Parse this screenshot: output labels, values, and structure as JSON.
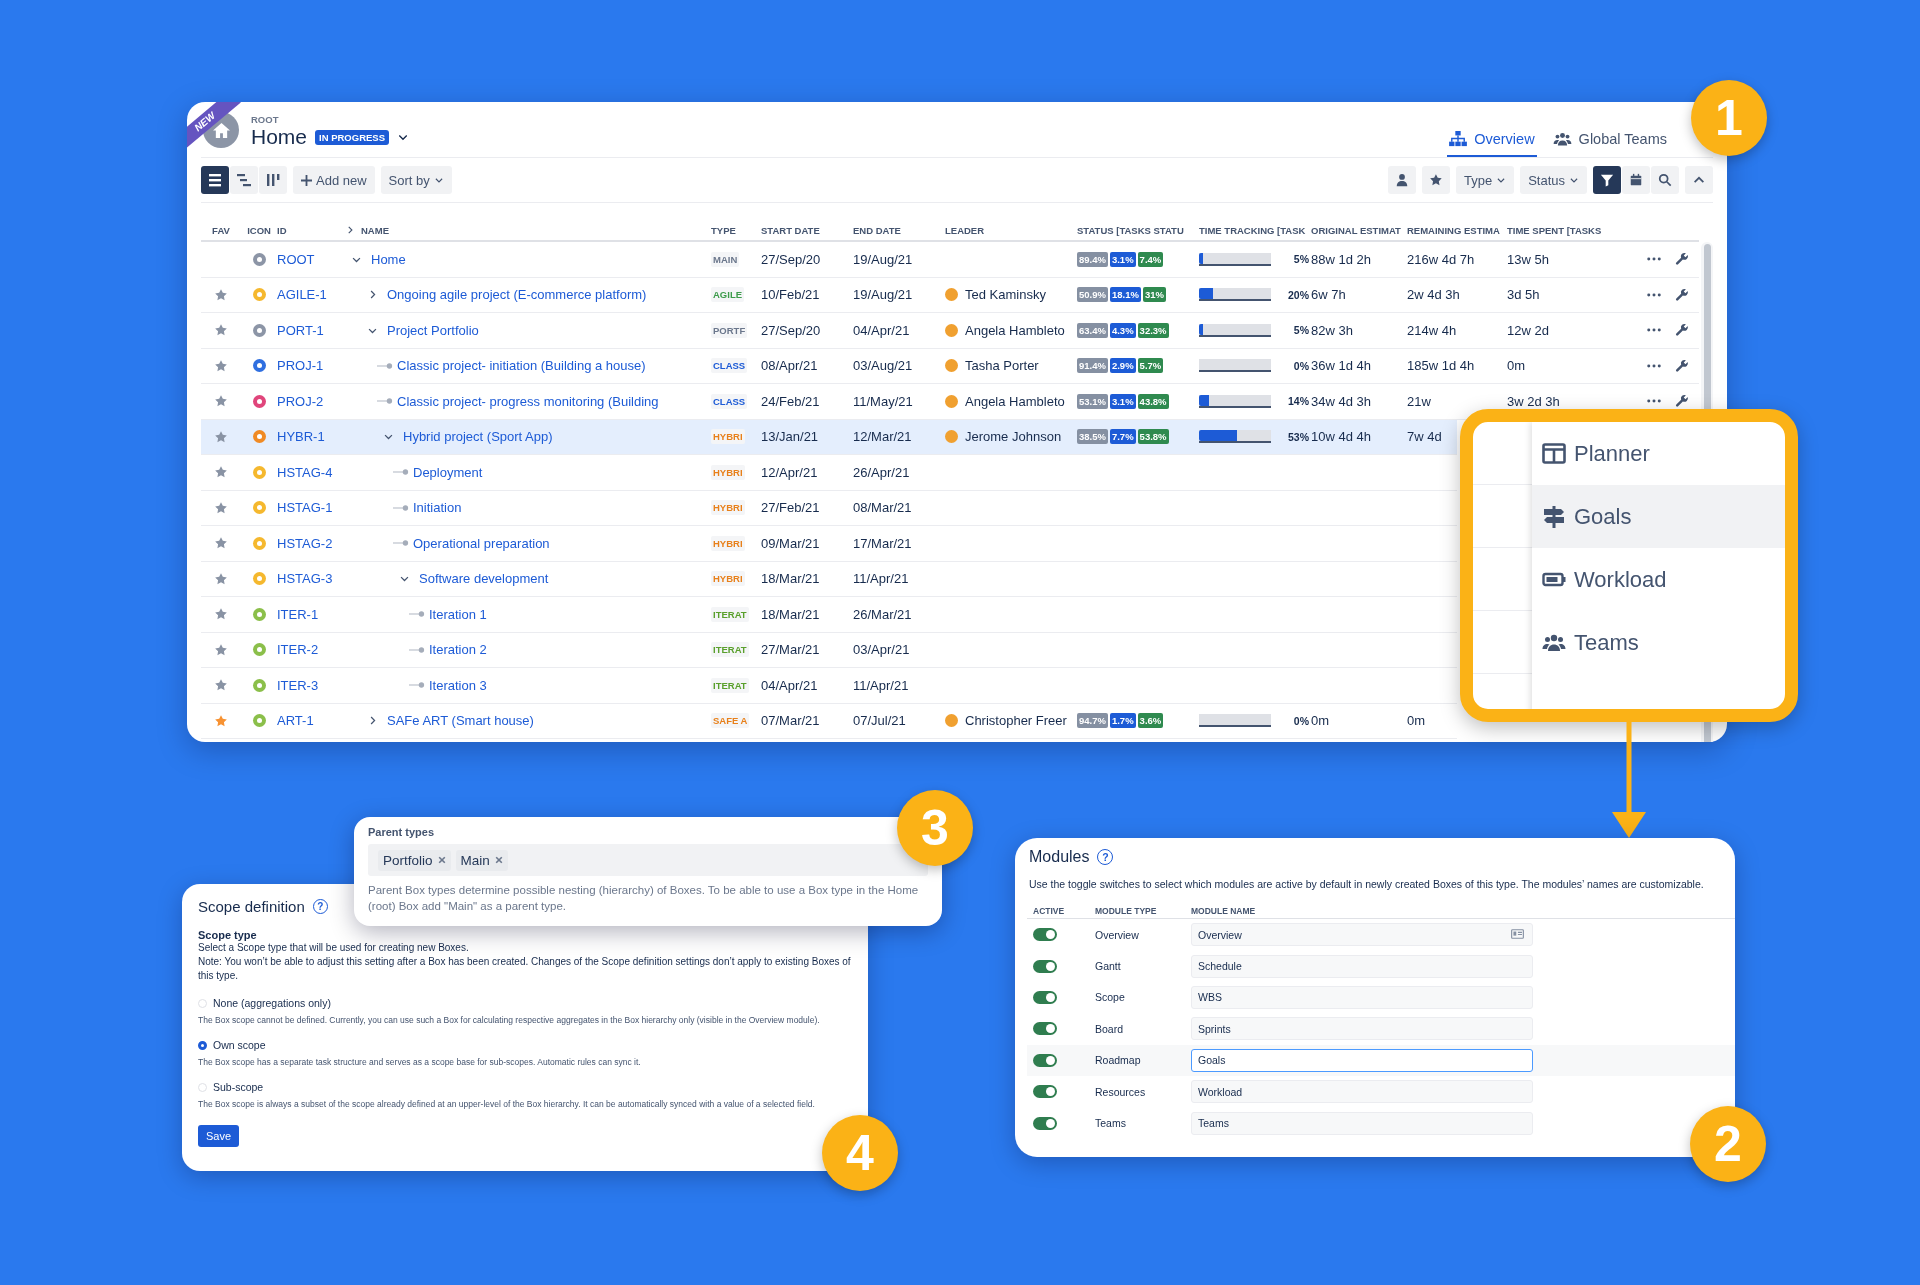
{
  "badges": [
    "1",
    "2",
    "3",
    "4"
  ],
  "header": {
    "ribbon": "NEW",
    "breadcrumb": "ROOT",
    "title": "Home",
    "status": "IN PROGRESS"
  },
  "tabs": [
    {
      "label": "Overview",
      "selected": true
    },
    {
      "label": "Global Teams",
      "selected": false
    }
  ],
  "toolbar": {
    "views": [
      {
        "selected": true
      },
      {
        "selected": false
      },
      {
        "selected": false
      }
    ],
    "add_new": "Add new",
    "sort_by": "Sort by",
    "type_filter": "Type",
    "status_filter": "Status",
    "filter_active": true
  },
  "table": {
    "columns": [
      "FAV",
      "ICON",
      "ID",
      "NAME",
      "TYPE",
      "START DATE",
      "END DATE",
      "LEADER",
      "STATUS [TASKS STATU",
      "TIME TRACKING [TASK",
      "ORIGINAL ESTIMAT",
      "REMAINING ESTIMA",
      "TIME SPENT [TASKS"
    ],
    "rows": [
      {
        "id": "ROOT",
        "name": "Home",
        "color": "#8c95a6",
        "type": {
          "label": "MAIN",
          "color": "#6b778c"
        },
        "start": "27/Sep/20",
        "end": "19/Aug/21",
        "status": [
          "89.4%",
          "3.1%",
          "7.4%"
        ],
        "tracking": {
          "level": 0.05,
          "reading": "5%"
        },
        "original": "88w 1d 2h",
        "remaining": "216w 4d 7h",
        "spent": "13w 5h",
        "actions": true,
        "selected": false,
        "kind": "branch",
        "expanded": true,
        "children": [
          {
            "id": "AGILE-1",
            "name": "Ongoing agile project (E-commerce platform)",
            "favorite": false,
            "color": "#f5b82e",
            "type": {
              "label": "AGILE",
              "color": "#3c9b4a"
            },
            "start": "10/Feb/21",
            "end": "19/Aug/21",
            "leader": "Ted Kaminsky",
            "status": [
              "50.9%",
              "18.1%",
              "31%"
            ],
            "tracking": {
              "level": 0.2,
              "reading": "20%"
            },
            "original": "6w 7h",
            "remaining": "2w 4d 3h",
            "spent": "3d 5h",
            "actions": true,
            "selected": false,
            "kind": "branch",
            "expanded": false
          },
          {
            "id": "PORT-1",
            "name": "Project Portfolio",
            "favorite": false,
            "color": "#8c95a6",
            "type": {
              "label": "PORTF",
              "color": "#6b778c"
            },
            "start": "27/Sep/20",
            "end": "04/Apr/21",
            "leader": "Angela Hambleto",
            "status": [
              "63.4%",
              "4.3%",
              "32.3%"
            ],
            "tracking": {
              "level": 0.05,
              "reading": "5%"
            },
            "original": "82w 3h",
            "remaining": "214w 4h",
            "spent": "12w 2d",
            "actions": true,
            "selected": false,
            "kind": "branch",
            "expanded": true,
            "children": [
              {
                "id": "PROJ-1",
                "name": "Classic project- initiation (Building a house)",
                "favorite": false,
                "color": "#2f6fe0",
                "type": {
                  "label": "CLASS",
                  "color": "#1d5bd6"
                },
                "start": "08/Apr/21",
                "end": "03/Aug/21",
                "leader": "Tasha Porter",
                "status": [
                  "91.4%",
                  "2.9%",
                  "5.7%"
                ],
                "tracking": {
                  "level": 0,
                  "reading": "0%"
                },
                "original": "36w 1d 4h",
                "remaining": "185w 1d 4h",
                "spent": "0m",
                "actions": true,
                "selected": false,
                "kind": "leaf"
              },
              {
                "id": "PROJ-2",
                "name": "Classic project- progress monitoring (Building",
                "favorite": false,
                "color": "#e0457b",
                "type": {
                  "label": "CLASS",
                  "color": "#1d5bd6"
                },
                "start": "24/Feb/21",
                "end": "11/May/21",
                "leader": "Angela Hambleto",
                "status": [
                  "53.1%",
                  "3.1%",
                  "43.8%"
                ],
                "tracking": {
                  "level": 0.14,
                  "reading": "14%"
                },
                "original": "34w 4d 3h",
                "remaining": "21w",
                "spent": "3w 2d 3h",
                "actions": true,
                "selected": false,
                "kind": "leaf"
              },
              {
                "id": "HYBR-1",
                "name": "Hybrid project (Sport App)",
                "favorite": false,
                "color": "#f08a24",
                "type": {
                  "label": "HYBRI",
                  "color": "#e8801a"
                },
                "start": "13/Jan/21",
                "end": "12/Mar/21",
                "leader": "Jerome Johnson",
                "status": [
                  "38.5%",
                  "7.7%",
                  "53.8%"
                ],
                "tracking": {
                  "level": 0.53,
                  "reading": "53%"
                },
                "original": "10w 4d 4h",
                "remaining": "7w 4d",
                "selected": true,
                "kind": "branch",
                "expanded": true,
                "children": [
                  {
                    "id": "HSTAG-4",
                    "name": "Deployment",
                    "favorite": false,
                    "color": "#f5b82e",
                    "type": {
                      "label": "HYBRI",
                      "color": "#e8801a"
                    },
                    "start": "12/Apr/21",
                    "end": "26/Apr/21",
                    "selected": false,
                    "kind": "leaf"
                  },
                  {
                    "id": "HSTAG-1",
                    "name": "Initiation",
                    "favorite": false,
                    "color": "#f5b82e",
                    "type": {
                      "label": "HYBRI",
                      "color": "#e8801a"
                    },
                    "start": "27/Feb/21",
                    "end": "08/Mar/21",
                    "selected": false,
                    "kind": "leaf"
                  },
                  {
                    "id": "HSTAG-2",
                    "name": "Operational preparation",
                    "favorite": false,
                    "color": "#f5b82e",
                    "type": {
                      "label": "HYBRI",
                      "color": "#e8801a"
                    },
                    "start": "09/Mar/21",
                    "end": "17/Mar/21",
                    "selected": false,
                    "kind": "leaf"
                  },
                  {
                    "id": "HSTAG-3",
                    "name": "Software development",
                    "favorite": false,
                    "color": "#f5b82e",
                    "type": {
                      "label": "HYBRI",
                      "color": "#e8801a"
                    },
                    "start": "18/Mar/21",
                    "end": "11/Apr/21",
                    "selected": false,
                    "kind": "branch",
                    "expanded": true,
                    "children": [
                      {
                        "id": "ITER-1",
                        "name": "Iteration 1",
                        "favorite": false,
                        "color": "#8bbf4a",
                        "type": {
                          "label": "ITERAT",
                          "color": "#5aa02c"
                        },
                        "start": "18/Mar/21",
                        "end": "26/Mar/21",
                        "selected": false,
                        "kind": "leaf"
                      },
                      {
                        "id": "ITER-2",
                        "name": "Iteration 2",
                        "favorite": false,
                        "color": "#8bbf4a",
                        "type": {
                          "label": "ITERAT",
                          "color": "#5aa02c"
                        },
                        "start": "27/Mar/21",
                        "end": "03/Apr/21",
                        "selected": false,
                        "kind": "leaf"
                      },
                      {
                        "id": "ITER-3",
                        "name": "Iteration 3",
                        "favorite": false,
                        "color": "#8bbf4a",
                        "type": {
                          "label": "ITERAT",
                          "color": "#5aa02c"
                        },
                        "start": "04/Apr/21",
                        "end": "11/Apr/21",
                        "selected": false,
                        "kind": "leaf"
                      }
                    ]
                  }
                ]
              }
            ]
          },
          {
            "id": "ART-1",
            "name": "SAFe ART (Smart house)",
            "favorite": true,
            "color": "#8bbf4a",
            "type": {
              "label": "SAFE A",
              "color": "#e8801a"
            },
            "start": "07/Mar/21",
            "end": "07/Jul/21",
            "leader": "Christopher Freer",
            "status": [
              "94.7%",
              "1.7%",
              "3.6%"
            ],
            "tracking": {
              "level": 0,
              "reading": "0%"
            },
            "original": "0m",
            "remaining": "0m",
            "selected": false,
            "kind": "branch",
            "expanded": false
          }
        ]
      }
    ]
  },
  "module_menu": [
    {
      "label": "Planner",
      "selected": false
    },
    {
      "label": "Goals",
      "selected": true
    },
    {
      "label": "Workload",
      "selected": false
    },
    {
      "label": "Teams",
      "selected": false
    }
  ],
  "modules": {
    "title": "Modules",
    "help": "?",
    "description": "Use the toggle switches to select which modules are active by default in newly created Boxes of this type. The modules’ names are customizable.",
    "columns": [
      "ACTIVE",
      "MODULE TYPE",
      "MODULE NAME"
    ],
    "rows": [
      {
        "type": "Overview",
        "name": "Overview",
        "active": true,
        "focused": false,
        "field_icon": true
      },
      {
        "type": "Gantt",
        "name": "Schedule",
        "active": true,
        "focused": false,
        "field_icon": false
      },
      {
        "type": "Scope",
        "name": "WBS",
        "active": true,
        "focused": false,
        "field_icon": false
      },
      {
        "type": "Board",
        "name": "Sprints",
        "active": true,
        "focused": false,
        "field_icon": false
      },
      {
        "type": "Roadmap",
        "name": "Goals",
        "active": true,
        "focused": true,
        "field_icon": false
      },
      {
        "type": "Resources",
        "name": "Workload",
        "active": true,
        "focused": false,
        "field_icon": false
      },
      {
        "type": "Teams",
        "name": "Teams",
        "active": true,
        "focused": false,
        "field_icon": false
      }
    ]
  },
  "parent_types": {
    "label": "Parent types",
    "chips": [
      "Portfolio",
      "Main"
    ],
    "description": "Parent Box types determine possible nesting (hierarchy) of Boxes. To be able to use a Box type in the Home (root) Box add \"Main\" as a parent type."
  },
  "scope": {
    "title": "Scope definition",
    "help": "?",
    "heading": "Scope type",
    "lines": [
      "Select a Scope type that will be used for creating new Boxes.",
      "Note: You won’t be able to adjust this setting after a Box has been created. Changes of the Scope definition settings don’t apply to existing Boxes of this type."
    ],
    "options": [
      {
        "label": "None (aggregations only)",
        "description": "The Box scope cannot be defined. Currently, you can use such a Box for calculating respective aggregates in the Box hierarchy only (visible in the Overview module).",
        "selected": false
      },
      {
        "label": "Own scope",
        "description": "The Box scope has a separate task structure and serves as a scope base for sub-scopes. Automatic rules can sync it.",
        "selected": true
      },
      {
        "label": "Sub-scope",
        "description": "The Box scope is always a subset of the scope already defined at an upper-level of the Box hierarchy. It can be automatically synced with a value of a selected field.",
        "selected": false
      }
    ],
    "save": "Save"
  }
}
